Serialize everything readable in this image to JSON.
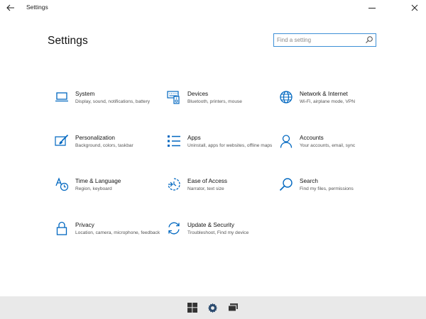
{
  "window": {
    "title": "Settings"
  },
  "page": {
    "title": "Settings"
  },
  "search": {
    "placeholder": "Find a setting",
    "value": ""
  },
  "colors": {
    "accent": "#0067c0",
    "search_border": "#3d8fd6",
    "taskbar": "#e9e9e9"
  },
  "items": [
    {
      "name": "System",
      "desc": "Display, sound, notifications, battery",
      "icon": "laptop-icon"
    },
    {
      "name": "Devices",
      "desc": "Bluetooth, printers, mouse",
      "icon": "keyboard-speaker-icon"
    },
    {
      "name": "Network & Internet",
      "desc": "Wi-Fi, airplane mode, VPN",
      "icon": "globe-icon"
    },
    {
      "name": "Personalization",
      "desc": "Background, colors, taskbar",
      "icon": "paint-brush-icon"
    },
    {
      "name": "Apps",
      "desc": "Uninstall, apps for websites, offline maps",
      "icon": "app-list-icon"
    },
    {
      "name": "Accounts",
      "desc": "Your accounts, email, sync",
      "icon": "person-icon"
    },
    {
      "name": "Time & Language",
      "desc": "Region, keyboard",
      "icon": "time-language-icon"
    },
    {
      "name": "Ease of Access",
      "desc": "Narrator, text size",
      "icon": "ease-of-access-icon"
    },
    {
      "name": "Search",
      "desc": "Find my files, permissions",
      "icon": "search-icon"
    },
    {
      "name": "Privacy",
      "desc": "Location, camera, microphone, feedback",
      "icon": "lock-icon"
    },
    {
      "name": "Update & Security",
      "desc": "Troubleshoot, Find my device",
      "icon": "sync-arrows-icon"
    }
  ],
  "taskbar": {
    "icons": [
      "windows-start-icon",
      "settings-gear-icon",
      "task-view-icon"
    ]
  }
}
